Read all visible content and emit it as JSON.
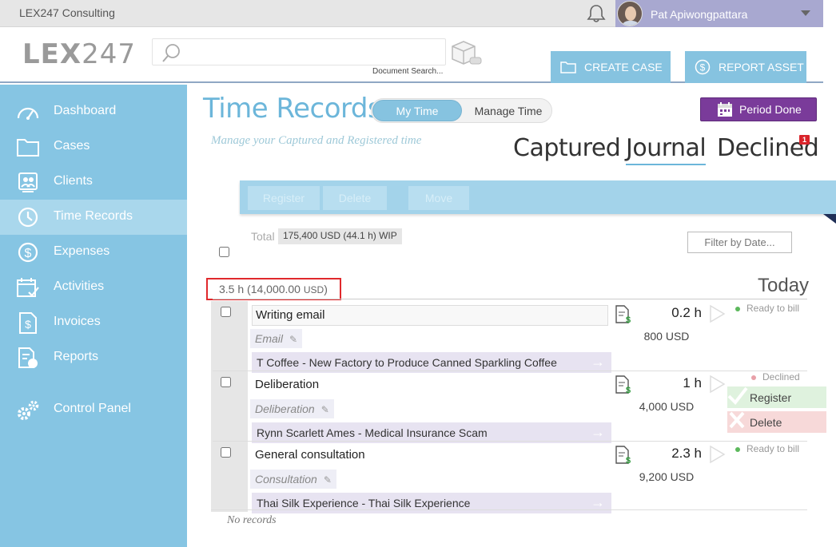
{
  "topbar": {
    "company": "LEX247 Consulting",
    "user_name": "Pat Apiwongpattara"
  },
  "header": {
    "logo_bold": "LEX",
    "logo_thin": "247",
    "search_placeholder": "",
    "document_search_label": "Document Search...",
    "create_case_label": "CREATE CASE",
    "report_asset_label": "REPORT ASSET"
  },
  "sidebar": {
    "items": [
      {
        "label": "Dashboard",
        "icon": "gauge-icon"
      },
      {
        "label": "Cases",
        "icon": "folder-icon"
      },
      {
        "label": "Clients",
        "icon": "contacts-icon"
      },
      {
        "label": "Time Records",
        "icon": "clock-icon"
      },
      {
        "label": "Expenses",
        "icon": "dollar-icon"
      },
      {
        "label": "Activities",
        "icon": "calendar-check-icon"
      },
      {
        "label": "Invoices",
        "icon": "invoice-icon"
      },
      {
        "label": "Reports",
        "icon": "report-icon"
      },
      {
        "label": "Control Panel",
        "icon": "gears-icon"
      }
    ],
    "active": "Time Records"
  },
  "page": {
    "title": "Time Records",
    "toggle_my": "My Time",
    "toggle_manage": "Manage Time",
    "subtitle": "Manage your Captured and Registered time",
    "period_done_label": "Period Done",
    "tabs": {
      "captured": "Captured",
      "journal": "Journal",
      "declined": "Declined",
      "declined_badge": "1"
    },
    "actions": {
      "register": "Register",
      "delete": "Delete",
      "move": "Move"
    },
    "total_label": "Total",
    "total_value": "175,400 USD (44.1 h)  WIP",
    "filter_by_date": "Filter by Date...",
    "group": {
      "hours": "3.5 h (14,000.00 ",
      "currency": "USD",
      "close": ")",
      "day": "Today"
    },
    "entries": [
      {
        "description": "Writing email",
        "activity": "Email",
        "matter": "T Coffee - New Factory to Produce Canned Sparkling Coffee",
        "hours": "0.2 h",
        "amount": "800 USD",
        "status": "Ready to bill"
      },
      {
        "description": "Deliberation",
        "activity": "Deliberation",
        "matter": "Rynn Scarlett Ames - Medical Insurance Scam",
        "hours": "1 h",
        "amount": "4,000 USD",
        "status": "Declined"
      },
      {
        "description": "General consultation",
        "activity": "Consultation",
        "matter": "Thai Silk Experience - Thai Silk Experience",
        "hours": "2.3 h",
        "amount": "9,200 USD",
        "status": "Ready to bill"
      }
    ],
    "declined_actions": {
      "register": "Register",
      "delete": "Delete"
    },
    "no_records": "No records"
  },
  "colors": {
    "sidebar": "#86c5e3",
    "accent": "#6cb6da",
    "period_done": "#7a3b9a",
    "highlight_box": "#e0292c",
    "ready_dot": "#5cb85c",
    "declined_dot": "#e8a0a8"
  }
}
